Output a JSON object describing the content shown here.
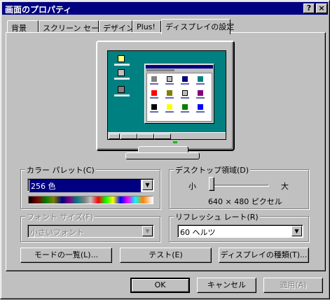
{
  "window": {
    "title": "画面のプロパティ",
    "help_glyph": "?",
    "close_glyph": "×"
  },
  "tabs": [
    {
      "label": "背景"
    },
    {
      "label": "スクリーン セーバー"
    },
    {
      "label": "デザイン"
    },
    {
      "label": "Plus!"
    },
    {
      "label": "ディスプレイの設定"
    }
  ],
  "color_palette": {
    "label": "カラー パレット(C)",
    "selected_value": "256 色"
  },
  "desktop_area": {
    "label": "デスクトップ領域(D)",
    "min_label": "小",
    "max_label": "大",
    "resolution": "640 × 480 ピクセル",
    "slider_level": 0
  },
  "font_size": {
    "label": "フォント サイズ(F)",
    "selected_value": "小さいフォント"
  },
  "refresh_rate": {
    "label": "リフレッシュ レート(R)",
    "selected_value": "60 ヘルツ"
  },
  "buttons": {
    "mode_list": "モードの一覧(L)...",
    "test": "テスト(E)",
    "display_type": "ディスプレイの種類(T)...",
    "ok": "OK",
    "cancel": "キャンセル",
    "apply": "適用(A)"
  }
}
